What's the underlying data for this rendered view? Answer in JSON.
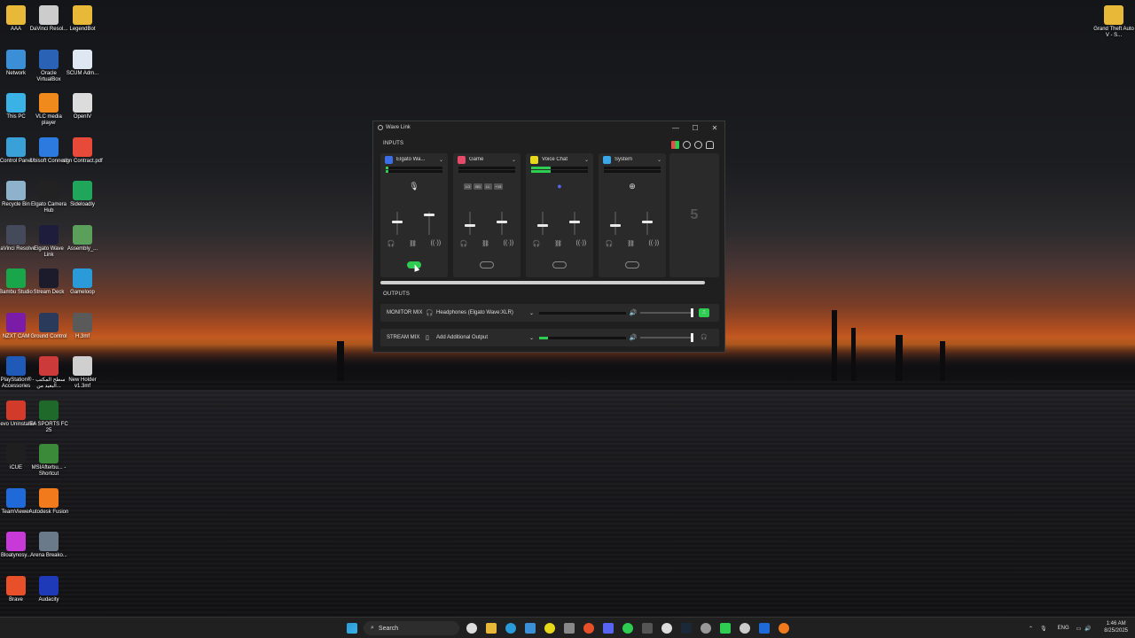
{
  "desktop": {
    "icons": [
      {
        "label": "AAA",
        "color": "#e8b839"
      },
      {
        "label": "DaVinci Resol...",
        "color": "#cccccc"
      },
      {
        "label": "LegendBot",
        "color": "#e8b839"
      },
      {
        "label": "Network",
        "color": "#3a8fd6"
      },
      {
        "label": "Oracle VirtualBox",
        "color": "#2a63b5"
      },
      {
        "label": "SCUM Adm...",
        "color": "#dfe8f2"
      },
      {
        "label": "This PC",
        "color": "#3ab2e6"
      },
      {
        "label": "VLC media player",
        "color": "#f08a1c"
      },
      {
        "label": "OpenIV",
        "color": "#dcdcdc"
      },
      {
        "label": "Control Panel",
        "color": "#3aa0d8"
      },
      {
        "label": "Ubisoft Connect",
        "color": "#2c7ae0"
      },
      {
        "label": "sign Contract.pdf",
        "color": "#e84a3a"
      },
      {
        "label": "Recycle Bin",
        "color": "#8fb2cc"
      },
      {
        "label": "Elgato Camera Hub",
        "color": "#222222"
      },
      {
        "label": "Sideloadly",
        "color": "#1fa65a"
      },
      {
        "label": "DaVinci Resolve",
        "color": "#444a5a"
      },
      {
        "label": "Elgato Wave Link",
        "color": "#1e1e3c"
      },
      {
        "label": "Assembly_...",
        "color": "#5aa05a"
      },
      {
        "label": "Bambu Studio",
        "color": "#19a64a"
      },
      {
        "label": "Stream Deck",
        "color": "#1b1b2b"
      },
      {
        "label": "Gameloop",
        "color": "#2a9ad8"
      },
      {
        "label": "NZXT CAM",
        "color": "#7a1ca8"
      },
      {
        "label": "Ground Control",
        "color": "#2a3a5a"
      },
      {
        "label": "H.3mf",
        "color": "#5a5a5a"
      },
      {
        "label": "PlayStation® Accessories",
        "color": "#1f5ab8"
      },
      {
        "label": "سطح المكتب - البعيد من...",
        "color": "#cc3a3a"
      },
      {
        "label": "New Holder v1.3mf",
        "color": "#cfcfcf"
      },
      {
        "label": "Revo Uninstaller",
        "color": "#d23a2a"
      },
      {
        "label": "EA SPORTS FC 25",
        "color": "#1f6a2a"
      },
      {
        "label": "iCUE",
        "color": "#1f1f1f"
      },
      {
        "label": "MSIAfterbu... - Shortcut",
        "color": "#3a8a3a"
      },
      {
        "label": "TeamViewer",
        "color": "#1f6ad8"
      },
      {
        "label": "Autodesk Fusion",
        "color": "#f07a1c"
      },
      {
        "label": "Bloatynosy...",
        "color": "#c83ad8"
      },
      {
        "label": "Arena Breako...",
        "color": "#6a7a8a"
      },
      {
        "label": "Brave",
        "color": "#e8502a"
      },
      {
        "label": "Audacity",
        "color": "#1f3ab8"
      },
      {
        "label": "Grand Theft Auto V - S...",
        "color": "#e8b839"
      }
    ]
  },
  "window": {
    "title": "Wave Link",
    "minimize": "—",
    "maximize": "☐",
    "close": "✕",
    "inputs_label": "INPUTS",
    "outputs_label": "OUTPUTS",
    "channels": [
      {
        "name": "Elgato Wa...",
        "color": "#3a6fe8",
        "icon": "🎙",
        "meter": 0.05,
        "toggle_on": true
      },
      {
        "name": "Game",
        "color": "#e84a6a",
        "icon": "",
        "meter": 0.0,
        "toggle_on": false
      },
      {
        "name": "Voice Chat",
        "color": "#e8d81c",
        "icon": "●",
        "meter": 0.35,
        "toggle_on": false
      },
      {
        "name": "System",
        "color": "#3aa8e8",
        "icon": "⊕",
        "meter": 0.0,
        "toggle_on": false
      }
    ],
    "game_fx": [
      "LG",
      "BG",
      "LL",
      "+15"
    ],
    "add_channel_number": "5",
    "outputs": [
      {
        "label": "MONITOR MIX",
        "device": "Headphones (Elgato Wave:XLR)",
        "meter": 0.0,
        "ear_color": "#2ecc51",
        "ear_glyph": "⎍"
      },
      {
        "label": "STREAM MIX",
        "device": "Add Additional Output",
        "meter": 0.1,
        "ear_color": "#2a2a2a",
        "ear_glyph": "🎧"
      }
    ]
  },
  "taskbar": {
    "search_placeholder": "Search",
    "language": "ENG",
    "time": "1:46 AM",
    "date": "8/25/2025"
  }
}
